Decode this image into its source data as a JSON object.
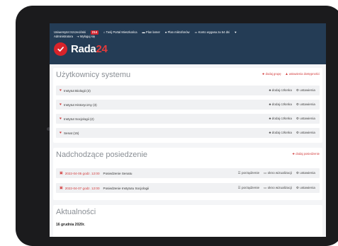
{
  "topbar": {
    "university": "Uniwersytet Szczeciński",
    "badge": "214",
    "portal_link": "Twój Portal Mieszkańca",
    "plan_mine": "Plan lamer",
    "plan_mikro": "Plan mikrofonów",
    "expiry": "Konto wygasa za 54 dni",
    "admin": "Administratora",
    "logout": "Wyloguj się"
  },
  "logo": {
    "text": "Rada",
    "number": "24"
  },
  "users": {
    "title": "Użytkownicy systemu",
    "add_group": "dodaj grupę",
    "settings_link": "ustawienia dostępności",
    "rows": [
      {
        "name": "Instytut Biologii (3)",
        "add": "dodaj członka",
        "settings": "ustawienia"
      },
      {
        "name": "Instytut Historyczny (3)",
        "add": "dodaj członka",
        "settings": "ustawienia"
      },
      {
        "name": "Instytut Socjologii (2)",
        "add": "dodaj członka",
        "settings": "ustawienia"
      },
      {
        "name": "Senat (15)",
        "add": "dodaj członka",
        "settings": "ustawienia"
      }
    ]
  },
  "meetings": {
    "title": "Nadchodzące posiedzenie",
    "add_meeting": "dodaj posiedzenie",
    "rows": [
      {
        "date": "2022-04-05 godz. 12:00",
        "name": "Posiedzenie Senatu",
        "agenda": "porządzenie",
        "vis": "okno wizualizacji",
        "settings": "ustawienia"
      },
      {
        "date": "2022-04-07 godz. 12:00",
        "name": "Posiedzenie Instytutu Socjologii",
        "agenda": "porządzenie",
        "vis": "okno wizualizacji",
        "settings": "ustawienia"
      }
    ]
  },
  "news": {
    "title": "Aktualności",
    "date": "16 grudnia 2020r."
  }
}
